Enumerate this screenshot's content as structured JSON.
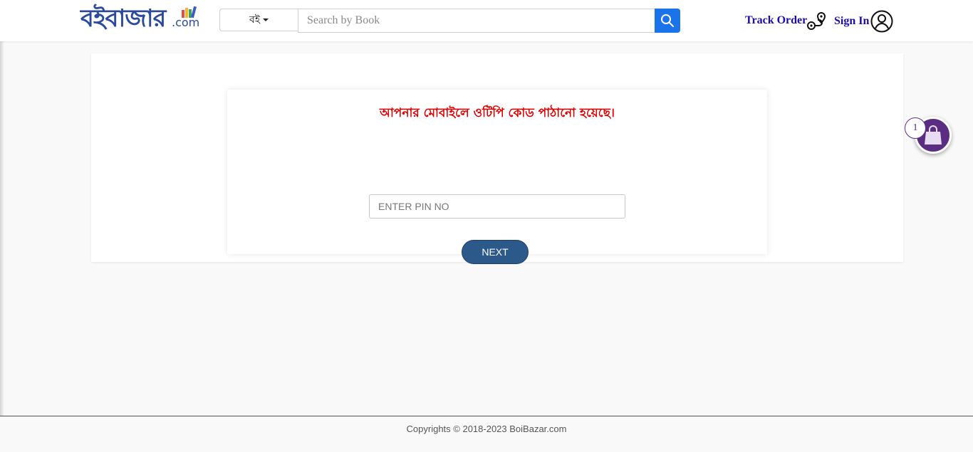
{
  "header": {
    "logo_text": "বইবাজার",
    "logo_suffix": ".com",
    "category_label": "বই",
    "search_placeholder": "Search by Book",
    "track_order_label": "Track Order",
    "sign_in_label": "Sign In",
    "icons": {
      "search": "search-icon",
      "track": "route-icon",
      "user": "user-icon"
    }
  },
  "otp": {
    "message": "আপনার মোবাইলে ওটিপি কোড পাঠানো হয়েছে।",
    "pin_placeholder": "ENTER PIN NO",
    "next_label": "NEXT"
  },
  "cart": {
    "count": "1",
    "icon": "shopping-bag-icon"
  },
  "footer": {
    "copyright": "Copyrights © 2018-2023 BoiBazar.com"
  },
  "colors": {
    "brand_blue": "#2b4a9c",
    "link_blue": "#1a0dab",
    "search_button": "#1a73e8",
    "alert_red": "#e10000",
    "next_button": "#2b5a8a",
    "cart_purple": "#5a2d82"
  }
}
